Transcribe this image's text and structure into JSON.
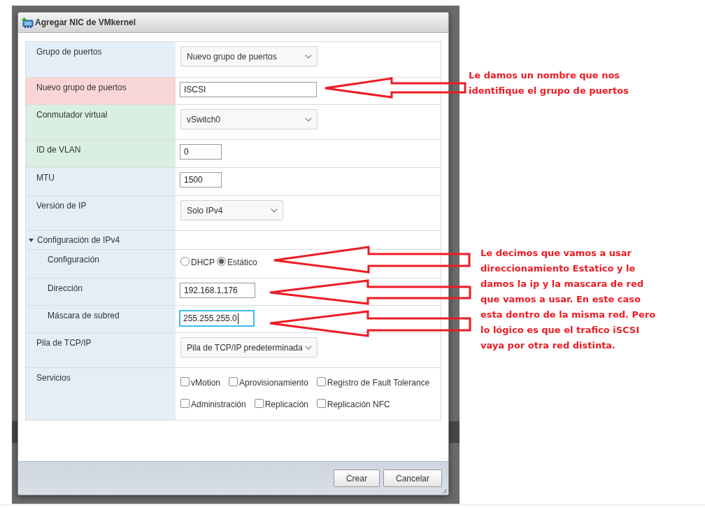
{
  "dialog": {
    "title": "Agregar NIC de VMkernel",
    "rows": [
      {
        "kind": "select",
        "label": "Grupo de puertos",
        "value": "Nuevo grupo de puertos",
        "color": "#e4eef6"
      },
      {
        "kind": "text-input",
        "label": "Nuevo grupo de puertos",
        "value": "ISCSI",
        "focused": false,
        "color": "#f9d6d6"
      },
      {
        "kind": "select",
        "label": "Conmutador virtual",
        "value": "vSwitch0",
        "color": "#d9efe1"
      },
      {
        "kind": "number-input",
        "label": "ID de VLAN",
        "value": "0",
        "focused": false,
        "color": "#d9efe1"
      },
      {
        "kind": "number-input",
        "label": "MTU",
        "value": "1500",
        "focused": false,
        "color": "#e4eef6"
      },
      {
        "kind": "select",
        "label": "Versión de IP",
        "value": "Solo IPv4",
        "color": "#e4eef6"
      },
      {
        "kind": "section",
        "label": "Configuración de IPv4",
        "expanded": true,
        "color": "#e4eef6",
        "children": [
          {
            "kind": "radio",
            "label": "Configuración",
            "color": "#e4eef6",
            "options": [
              {
                "label": "DHCP",
                "selected": false
              },
              {
                "label": "Estático",
                "selected": true
              }
            ]
          },
          {
            "kind": "ip-input",
            "label": "Dirección",
            "value": "192.168.1,176",
            "focused": false,
            "color": "#e4eef6"
          },
          {
            "kind": "ip-input",
            "label": "Máscara de subred",
            "value": "255.255.255.0",
            "focused": true,
            "color": "#e4eef6"
          }
        ]
      },
      {
        "kind": "select",
        "label": "Pila de TCP/IP",
        "value": "Pila de TCP/IP predeterminada",
        "color": "#e4eef6"
      },
      {
        "kind": "checkboxes",
        "label": "Servicios",
        "color": "#e4eef6",
        "options": [
          {
            "label": "vMotion",
            "checked": false
          },
          {
            "label": "Aprovisionamiento",
            "checked": false
          },
          {
            "label": "Registro de Fault Tolerance",
            "checked": false
          },
          {
            "label": "Administración",
            "checked": false
          },
          {
            "label": "Replicación",
            "checked": false
          },
          {
            "label": "Replicación NFC",
            "checked": false
          }
        ]
      }
    ],
    "buttons": [
      {
        "label": "Crear"
      },
      {
        "label": "Cancelar"
      }
    ]
  },
  "annotations": [
    {
      "text": "Le damos un nombre que nos\nidentifique el grupo de puertos"
    },
    {
      "text": "Le decimos que vamos a usar\ndireccionamiento Estatico y le\ndamos la ip y la mascara de red\nque vamos a usar. En este caso\nesta dentro de la misma red. Pero\nlo lógico es que el trafico iSCSI\nvaya por otra red distinta."
    }
  ]
}
